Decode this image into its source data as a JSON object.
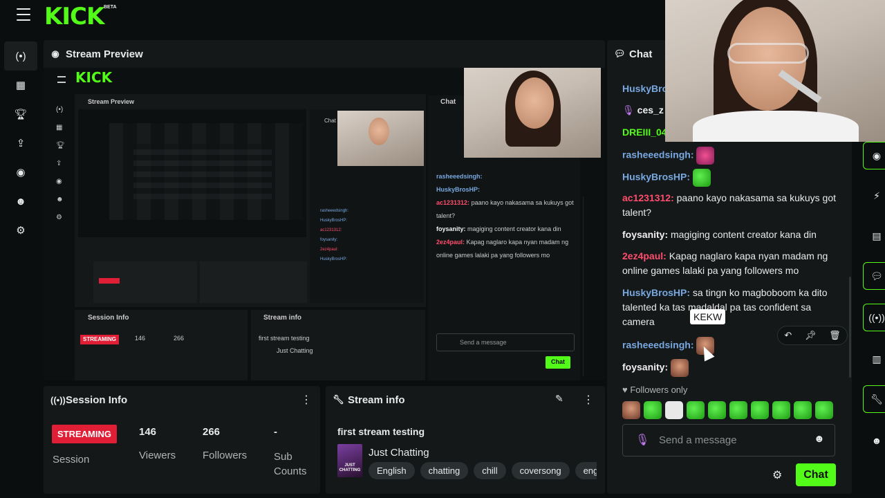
{
  "app": {
    "logo": "KICK",
    "beta": "BETA"
  },
  "sidenav": [
    {
      "icon": "live-icon"
    },
    {
      "icon": "analytics-icon"
    },
    {
      "icon": "trophy-icon"
    },
    {
      "icon": "upload-icon"
    },
    {
      "icon": "screen-icon"
    },
    {
      "icon": "users-icon"
    },
    {
      "icon": "gear-icon"
    }
  ],
  "preview": {
    "title": "Stream Preview"
  },
  "chat": {
    "title": "Chat",
    "partial_users": [
      "HuskyBro",
      "ces_z",
      "DREIII_04"
    ],
    "messages": [
      {
        "user": "rasheeedsingh:",
        "color": "blue",
        "text": ""
      },
      {
        "user": "HuskyBrosHP:",
        "color": "blue",
        "text": ""
      },
      {
        "user": "ac1231312:",
        "color": "red",
        "text": "paano kayo nakasama sa kukuys got talent?"
      },
      {
        "user": "foysanity:",
        "color": "white",
        "text": "magiging content creator kana din"
      },
      {
        "user": "2ez4paul:",
        "color": "red",
        "text": "Kapag naglaro kapa nyan madam ng online games lalaki pa yang followers mo"
      },
      {
        "user": "HuskyBrosHP:",
        "color": "blue",
        "text": "sa tingn ko magboboom ka dito talented ka tas madaldal pa tas confident sa camera"
      },
      {
        "user": "rasheeedsingh:",
        "color": "blue",
        "text": ""
      },
      {
        "user": "foysanity:",
        "color": "white",
        "text": ""
      }
    ],
    "tooltip": "KEKW",
    "followers_only": "Followers only",
    "send_placeholder": "Send a message",
    "send_button": "Chat"
  },
  "session": {
    "title": "Session Info",
    "status": "STREAMING",
    "status_label": "Session",
    "viewers": "146",
    "viewers_label": "Viewers",
    "followers": "266",
    "followers_label": "Followers",
    "subs": "-",
    "subs_label": "Sub Counts"
  },
  "streaminfo": {
    "title": "Stream info",
    "stream_title": "first stream testing",
    "category": "Just Chatting",
    "category_thumb": "JUST CHATTING",
    "tags": [
      "English",
      "chatting",
      "chill",
      "coversong",
      "englis"
    ]
  },
  "colors": {
    "accent": "#53fc18",
    "streaming": "#e01f36"
  }
}
